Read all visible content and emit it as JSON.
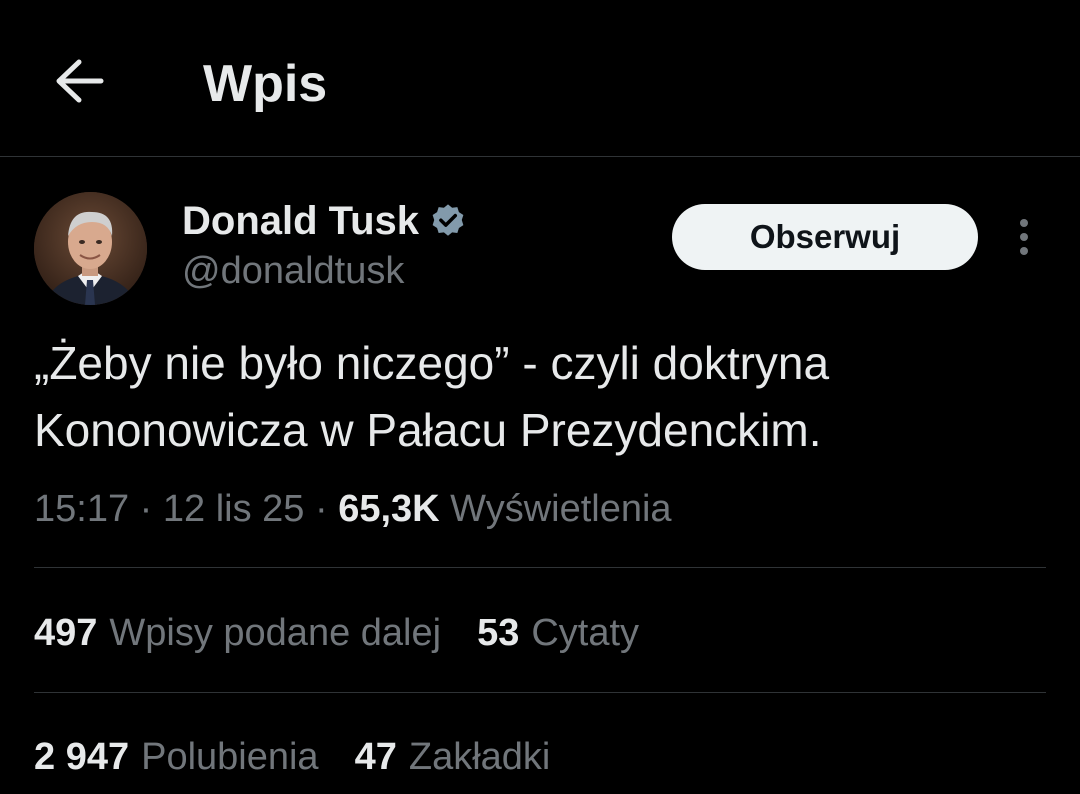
{
  "header": {
    "title": "Wpis"
  },
  "author": {
    "name": "Donald Tusk",
    "handle": "@donaldtusk",
    "verified_badge_color": "#829aab"
  },
  "follow_button": {
    "label": "Obserwuj"
  },
  "tweet": {
    "text_line1": "„Żeby nie było niczego” - czyli doktryna",
    "text_line2": "Kononowicza w Pałacu Prezydenckim."
  },
  "meta": {
    "time": "15:17",
    "separator": "·",
    "date": "12 lis 25",
    "views_count": "65,3K",
    "views_label": "Wyświetlenia"
  },
  "stats": {
    "reposts_count": "497",
    "reposts_label": "Wpisy podane dalej",
    "quotes_count": "53",
    "quotes_label": "Cytaty",
    "likes_count": "2 947",
    "likes_label": "Polubienia",
    "bookmarks_count": "47",
    "bookmarks_label": "Zakładki"
  },
  "icons": {
    "back": "arrow-left-icon",
    "verified": "verified-badge-icon",
    "more": "more-vertical-icon"
  },
  "colors": {
    "background": "#000000",
    "text_primary": "#e7e9ea",
    "text_secondary": "#71767b",
    "divider": "#2f3336",
    "follow_bg": "#eff3f4"
  }
}
